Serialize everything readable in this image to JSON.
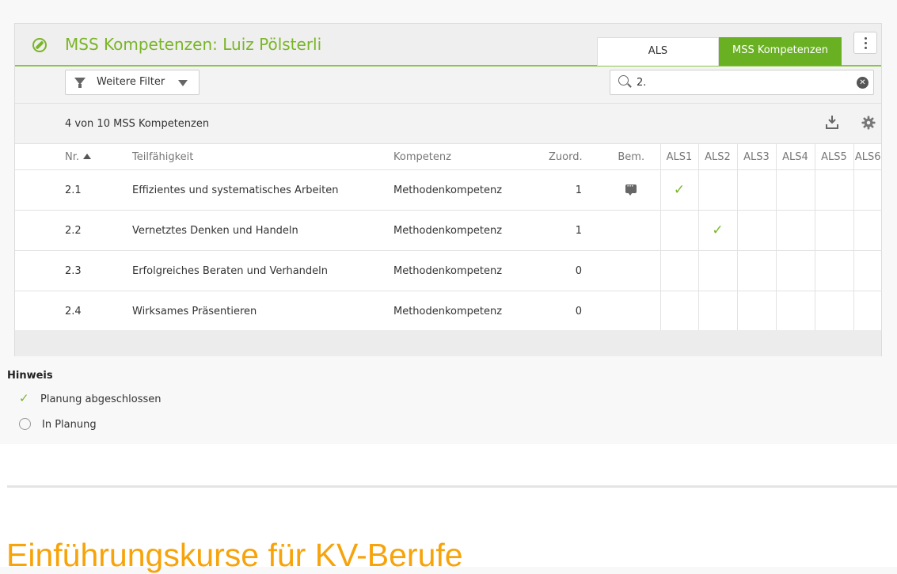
{
  "panel": {
    "title": "MSS Kompetenzen: Luiz Pölsterli",
    "tabs": [
      {
        "label": "ALS",
        "active": false
      },
      {
        "label": "MSS Kompetenzen",
        "active": true
      }
    ]
  },
  "filter": {
    "button_label": "Weitere Filter",
    "search_value": "2."
  },
  "list": {
    "count_text": "4 von 10 MSS Kompetenzen"
  },
  "table": {
    "columns": [
      "Nr.",
      "Teilfähigkeit",
      "Kompetenz",
      "Zuord.",
      "Bem.",
      "ALS1",
      "ALS2",
      "ALS3",
      "ALS4",
      "ALS5",
      "ALS6"
    ],
    "sort": {
      "column": "Nr.",
      "direction": "ascending"
    },
    "rows": [
      {
        "nr": "2.1",
        "teil": "Effizientes und systematisches Arbeiten",
        "komp": "Methodenkompetenz",
        "zuord": "1",
        "comment": true,
        "als": [
          true,
          false,
          false,
          false,
          false,
          false
        ]
      },
      {
        "nr": "2.2",
        "teil": "Vernetztes Denken und Handeln",
        "komp": "Methodenkompetenz",
        "zuord": "1",
        "comment": false,
        "als": [
          false,
          true,
          false,
          false,
          false,
          false
        ]
      },
      {
        "nr": "2.3",
        "teil": "Erfolgreiches Beraten und Verhandeln",
        "komp": "Methodenkompetenz",
        "zuord": "0",
        "comment": false,
        "als": [
          false,
          false,
          false,
          false,
          false,
          false
        ]
      },
      {
        "nr": "2.4",
        "teil": "Wirksames Präsentieren",
        "komp": "Methodenkompetenz",
        "zuord": "0",
        "comment": false,
        "als": [
          false,
          false,
          false,
          false,
          false,
          false
        ]
      }
    ]
  },
  "legend": {
    "title": "Hinweis",
    "items": [
      {
        "icon": "check-icon",
        "label": "Planung abgeschlossen"
      },
      {
        "icon": "circle-icon",
        "label": "In Planung"
      }
    ]
  },
  "section": {
    "title": "Einführungskurse für KV-Berufe"
  },
  "colors": {
    "accent_green": "#7ab527",
    "active_tab": "#6ab023",
    "section_orange": "#f7a30a"
  }
}
